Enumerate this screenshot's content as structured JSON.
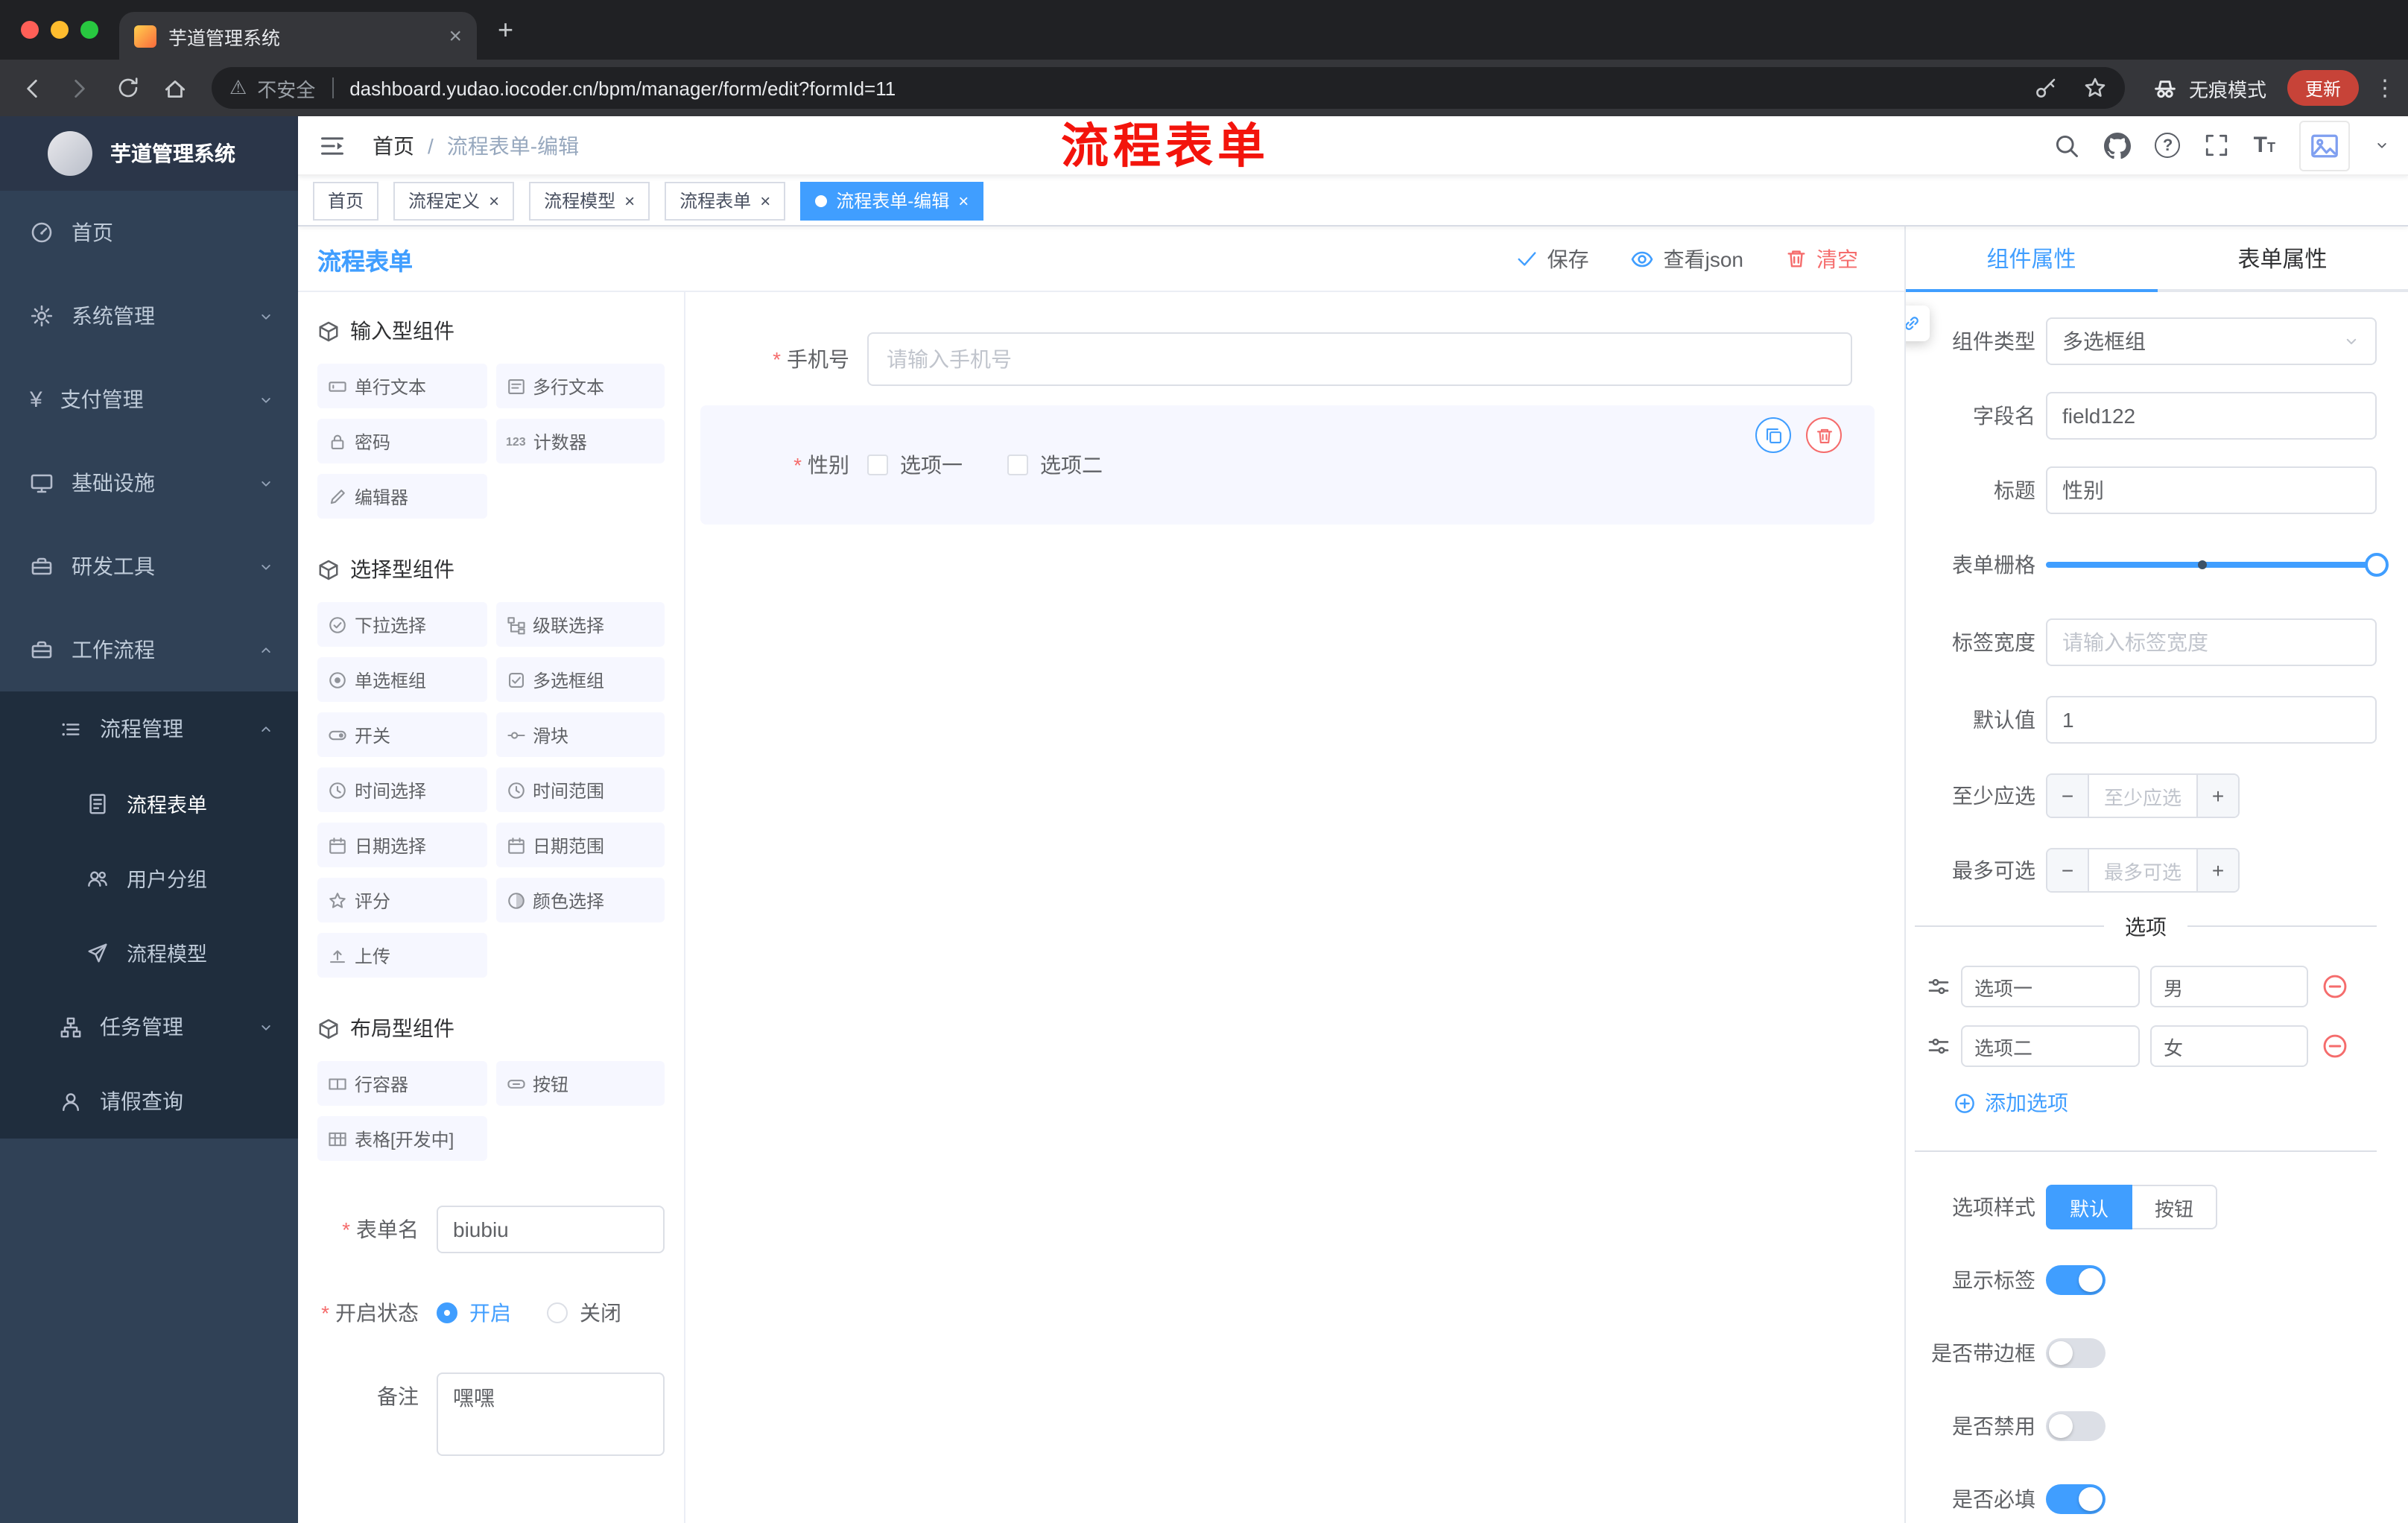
{
  "colors": {
    "primary": "#409eff",
    "danger": "#f56c6c",
    "annotation_red": "#f3140c",
    "sidebar_bg": "#304156",
    "sidebar_submenu_bg": "#1f2d3d",
    "update_badge": "#c74338"
  },
  "browser": {
    "tab_title": "芋道管理系统",
    "security_label": "不安全",
    "url": "dashboard.yudao.iocoder.cn/bpm/manager/form/edit?formId=11",
    "incognito_label": "无痕模式",
    "update_label": "更新"
  },
  "sidebar": {
    "brand": "芋道管理系统",
    "items": [
      {
        "label": "首页"
      },
      {
        "label": "系统管理"
      },
      {
        "label": "支付管理"
      },
      {
        "label": "基础设施"
      },
      {
        "label": "研发工具"
      },
      {
        "label": "工作流程"
      },
      {
        "label": "流程管理"
      },
      {
        "label": "流程表单"
      },
      {
        "label": "用户分组"
      },
      {
        "label": "流程模型"
      },
      {
        "label": "任务管理"
      },
      {
        "label": "请假查询"
      }
    ]
  },
  "header": {
    "breadcrumb_home": "首页",
    "breadcrumb_separator": "/",
    "breadcrumb_current": "流程表单-编辑",
    "annotation": "流程表单"
  },
  "tags": [
    {
      "label": "首页"
    },
    {
      "label": "流程定义"
    },
    {
      "label": "流程模型"
    },
    {
      "label": "流程表单"
    },
    {
      "label": "流程表单-编辑"
    }
  ],
  "designer": {
    "title": "流程表单",
    "actions": {
      "save": "保存",
      "view_json": "查看json",
      "clear": "清空"
    },
    "groups": [
      {
        "title": "输入型组件",
        "items": [
          "单行文本",
          "多行文本",
          "密码",
          "计数器",
          "编辑器"
        ]
      },
      {
        "title": "选择型组件",
        "items": [
          "下拉选择",
          "级联选择",
          "单选框组",
          "多选框组",
          "开关",
          "滑块",
          "时间选择",
          "时间范围",
          "日期选择",
          "日期范围",
          "评分",
          "颜色选择",
          "上传"
        ]
      },
      {
        "title": "布局型组件",
        "items": [
          "行容器",
          "按钮",
          "表格[开发中]"
        ]
      }
    ],
    "meta": {
      "form_name_label": "表单名",
      "form_name_value": "biubiu",
      "status_label": "开启状态",
      "status_on": "开启",
      "status_off": "关闭",
      "remark_label": "备注",
      "remark_value": "嘿嘿"
    },
    "canvas": {
      "phone_label": "手机号",
      "phone_placeholder": "请输入手机号",
      "gender_label": "性别",
      "gender_options": [
        "选项一",
        "选项二"
      ]
    }
  },
  "props": {
    "tab_component": "组件属性",
    "tab_form": "表单属性",
    "rows": {
      "type_label": "组件类型",
      "type_value": "多选框组",
      "field_label": "字段名",
      "field_value": "field122",
      "title_label": "标题",
      "title_value": "性别",
      "grid_label": "表单栅格",
      "label_width_label": "标签宽度",
      "label_width_placeholder": "请输入标签宽度",
      "default_label": "默认值",
      "default_value": "1",
      "min_label": "至少应选",
      "min_placeholder": "至少应选",
      "max_label": "最多可选",
      "max_placeholder": "最多可选"
    },
    "options_divider": "选项",
    "options": [
      {
        "label": "选项一",
        "value": "男"
      },
      {
        "label": "选项二",
        "value": "女"
      }
    ],
    "add_option": "添加选项",
    "style_label": "选项样式",
    "style_default": "默认",
    "style_button": "按钮",
    "switches": [
      {
        "label": "显示标签",
        "on": true
      },
      {
        "label": "是否带边框",
        "on": false
      },
      {
        "label": "是否禁用",
        "on": false
      },
      {
        "label": "是否必填",
        "on": true
      }
    ]
  }
}
